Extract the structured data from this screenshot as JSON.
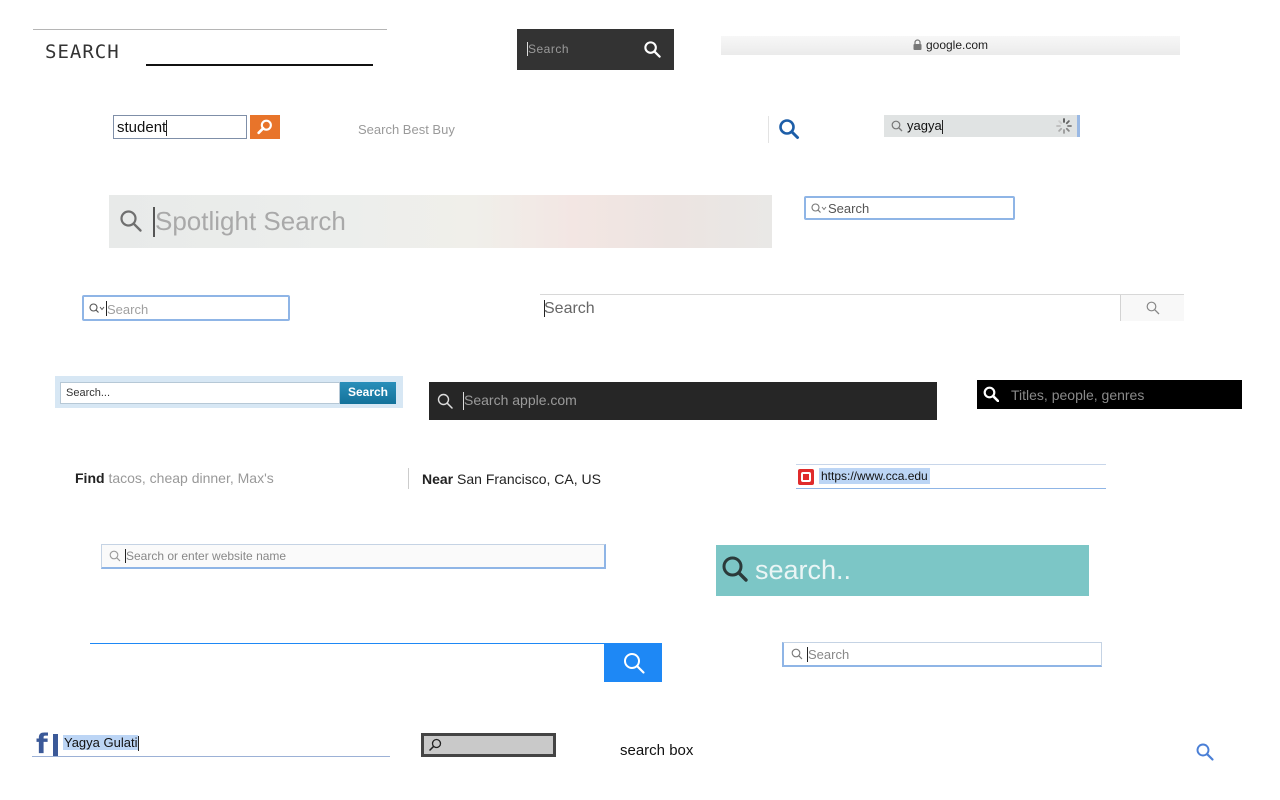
{
  "boxes": {
    "retro": {
      "label": "SEARCH"
    },
    "dark_small": {
      "placeholder": "Search"
    },
    "safari_url": {
      "url": "google.com"
    },
    "student": {
      "value": "student"
    },
    "bestbuy": {
      "placeholder": "Search Best Buy"
    },
    "yagya_loading": {
      "value": "yagya"
    },
    "spotlight": {
      "placeholder": "Spotlight Search"
    },
    "mac_field_1": {
      "placeholder": "Search"
    },
    "mac_field_2": {
      "placeholder": "Search"
    },
    "wide_field": {
      "placeholder": "Search"
    },
    "blue_button_field": {
      "placeholder": "Search...",
      "button": "Search"
    },
    "apple": {
      "placeholder": "Search apple.com"
    },
    "netflix": {
      "placeholder": "Titles, people, genres"
    },
    "yelp": {
      "find_label": "Find",
      "find_placeholder": "tacos, cheap dinner, Max's",
      "near_label": "Near",
      "near_value": "San Francisco, CA, US"
    },
    "cca_url": {
      "url": "https://www.cca.edu"
    },
    "safari_website": {
      "placeholder": "Search or enter website name"
    },
    "teal": {
      "placeholder": "search.."
    },
    "finder_search": {
      "placeholder": "Search"
    },
    "facebook": {
      "value": "Yagya Gulati",
      "logo": "f"
    },
    "caption": {
      "text": "search box"
    }
  },
  "icons": {
    "magnifier": "search-icon",
    "lock": "lock-icon",
    "spinner": "spinner-icon",
    "logo": "cca-logo-icon"
  },
  "colors": {
    "orange": "#e8742a",
    "blue_button": "#1a7fa8",
    "teal": "#7cc6c6",
    "bright_blue": "#1e88f5",
    "bestbuy_blue": "#1d5ea8",
    "facebook_blue": "#3b5998",
    "mac_focus": "#8fb5e6"
  }
}
